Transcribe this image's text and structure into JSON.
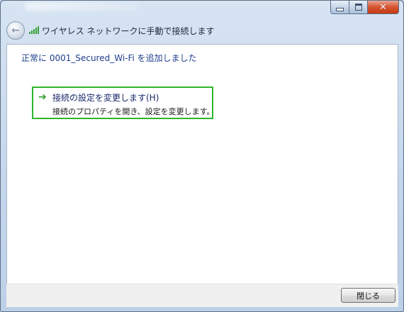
{
  "window": {
    "caption_buttons": {
      "minimize_icon": "minimize-icon",
      "maximize_icon": "maximize-icon",
      "close_icon": "close-icon",
      "close_glyph": "✕"
    }
  },
  "nav": {
    "back_icon": "back-arrow-icon",
    "back_glyph": "←",
    "network_icon": "wifi-signal-icon",
    "title": "ワイヤレス ネットワークに手動で接続します"
  },
  "content": {
    "heading": "正常に 0001_Secured_Wi-Fi を追加しました",
    "command_link": {
      "arrow_icon": "green-arrow-icon",
      "arrow_glyph": "➔",
      "title": "接続の設定を変更します(H)",
      "description": "接続のプロパティを開き、設定を変更します。",
      "accent_color": "#2fb52f"
    }
  },
  "footer": {
    "close_label": "閉じる"
  }
}
